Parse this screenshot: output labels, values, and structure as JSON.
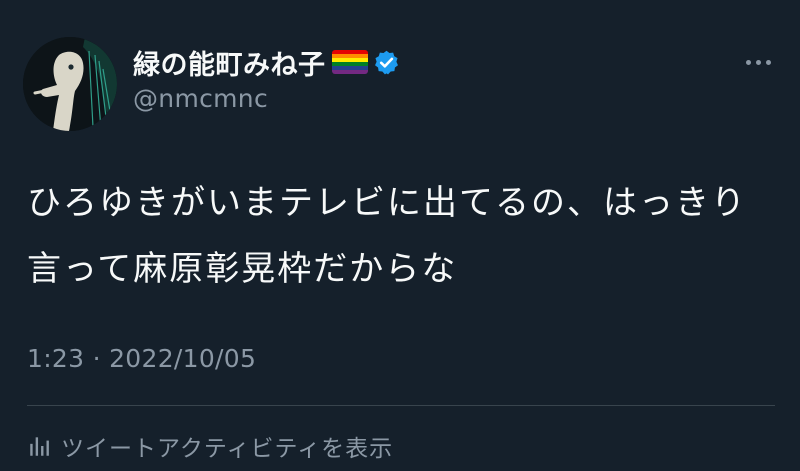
{
  "author": {
    "display_name": "緑の能町みね子",
    "username": "@nmcmnc",
    "flag_icon": "rainbow-flag-icon",
    "verified_icon": "verified-badge-icon",
    "verified_color": "#1d9bf0"
  },
  "tweet": {
    "text": "ひろゆきがいまテレビに出てるの、はっきり言って麻原彰晃枠だからな",
    "time": "1:23",
    "separator": "·",
    "date": "2022/10/05"
  },
  "actions": {
    "more_icon": "more-options-icon",
    "activity_icon": "analytics-icon",
    "activity_label": "ツイートアクティビティを表示"
  },
  "colors": {
    "background": "#15202b",
    "text_primary": "#f7f9f9",
    "text_secondary": "#8b98a5",
    "divider": "#38444d",
    "rainbow": [
      "#e40303",
      "#ff8c00",
      "#ffed00",
      "#008026",
      "#24408e",
      "#732982"
    ]
  }
}
